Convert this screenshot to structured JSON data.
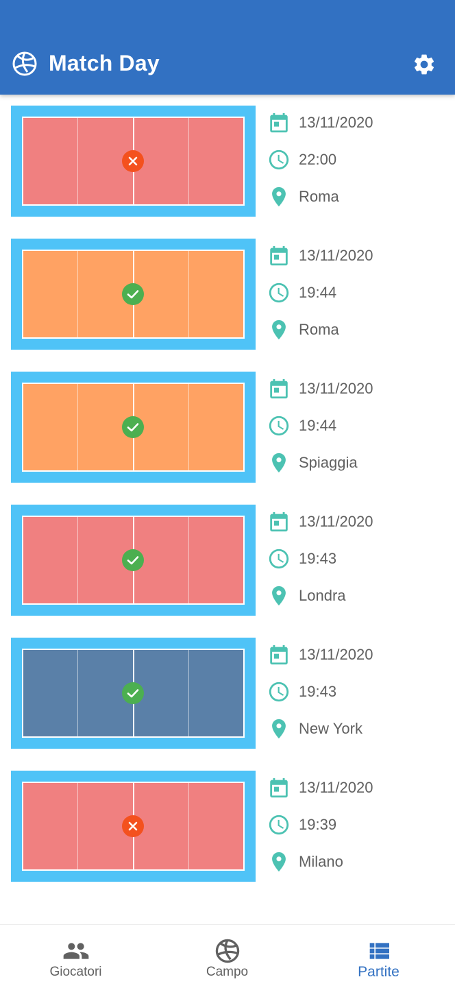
{
  "app": {
    "title": "Match Day",
    "logo_icon": "volleyball-icon",
    "settings_icon": "gear-icon",
    "bar_color": "#3271c2"
  },
  "matches": [
    {
      "date": "13/11/2020",
      "time": "22:00",
      "place": "Roma",
      "court_color": "#f08080",
      "status": "lost",
      "status_color": "#f4511e"
    },
    {
      "date": "13/11/2020",
      "time": "19:44",
      "place": "Roma",
      "court_color": "#ffa263",
      "status": "won",
      "status_color": "#4caf50"
    },
    {
      "date": "13/11/2020",
      "time": "19:44",
      "place": "Spiaggia",
      "court_color": "#ffa263",
      "status": "won",
      "status_color": "#4caf50"
    },
    {
      "date": "13/11/2020",
      "time": "19:43",
      "place": "Londra",
      "court_color": "#f08080",
      "status": "won",
      "status_color": "#4caf50"
    },
    {
      "date": "13/11/2020",
      "time": "19:43",
      "place": "New York",
      "court_color": "#5a80a8",
      "status": "won",
      "status_color": "#4caf50"
    },
    {
      "date": "13/11/2020",
      "time": "19:39",
      "place": "Milano",
      "court_color": "#f08080",
      "status": "lost",
      "status_color": "#f4511e"
    }
  ],
  "colors": {
    "court_border": "#4fc3f7",
    "info_icon": "#4cc2b2",
    "nav_active": "#3271c2",
    "nav_inactive": "#616161"
  },
  "bottom_nav": [
    {
      "label": "Giocatori",
      "icon": "people-icon",
      "active": false
    },
    {
      "label": "Campo",
      "icon": "volleyball-icon",
      "active": false
    },
    {
      "label": "Partite",
      "icon": "list-icon",
      "active": true
    }
  ]
}
